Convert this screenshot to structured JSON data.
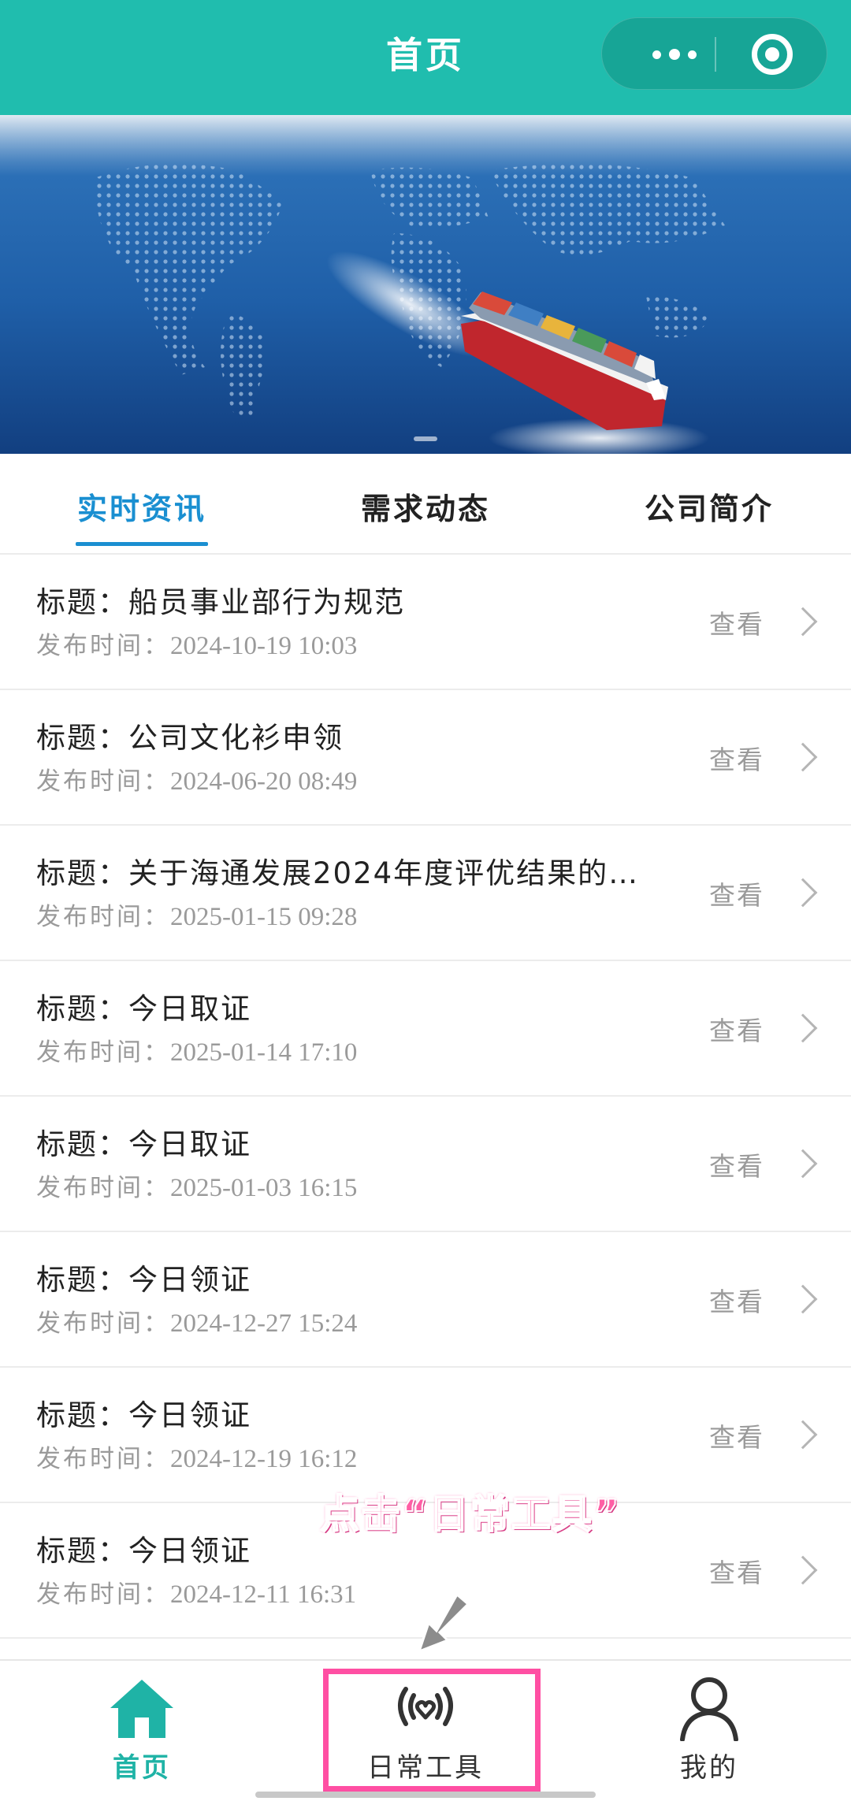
{
  "header": {
    "title": "首页",
    "more_icon": "more-dots-icon",
    "close_icon": "target-close-icon",
    "bg_color": "#20bdae"
  },
  "banner": {
    "description_icon": "cargo-ship-banner"
  },
  "tabs": [
    {
      "label": "实时资讯",
      "active": true
    },
    {
      "label": "需求动态",
      "active": false
    },
    {
      "label": "公司简介",
      "active": false
    }
  ],
  "news": {
    "title_prefix": "标题：",
    "time_prefix": "发布时间：",
    "view_label": "查看",
    "items": [
      {
        "title": "船员事业部行为规范",
        "time": "2024-10-19 10:03"
      },
      {
        "title": "公司文化衫申领",
        "time": "2024-06-20 08:49"
      },
      {
        "title": "关于海通发展2024年度评优结果的…",
        "time": "2025-01-15 09:28"
      },
      {
        "title": "今日取证",
        "time": "2025-01-14 17:10"
      },
      {
        "title": "今日取证",
        "time": "2025-01-03 16:15"
      },
      {
        "title": "今日领证",
        "time": "2024-12-27 15:24"
      },
      {
        "title": "今日领证",
        "time": "2024-12-19 16:12"
      },
      {
        "title": "今日领证",
        "time": "2024-12-11 16:31"
      }
    ]
  },
  "annotation": {
    "text": "点击“日常工具”",
    "color": "#ff5fa5"
  },
  "bottom_nav": [
    {
      "label": "首页",
      "icon": "home-icon",
      "active": true
    },
    {
      "label": "日常工具",
      "icon": "tools-signal-heart-icon",
      "active": false
    },
    {
      "label": "我的",
      "icon": "user-icon",
      "active": false
    }
  ],
  "accent_color": "#1a8fd1",
  "highlight_color": "#ff4fa3"
}
